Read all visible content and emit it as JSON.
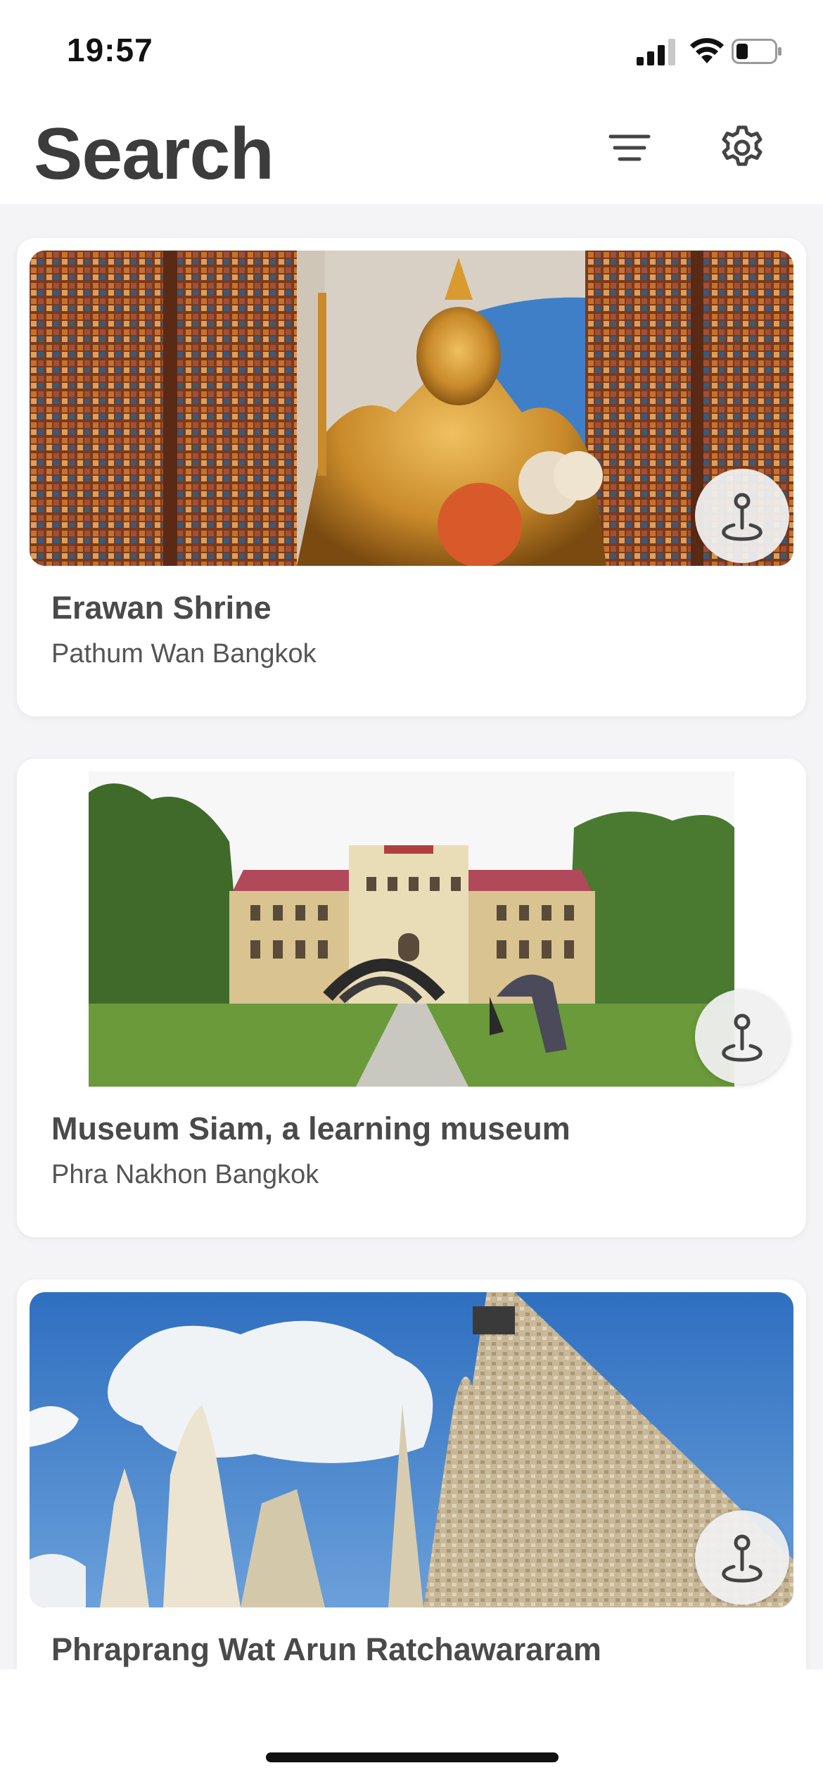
{
  "status_bar": {
    "time": "19:57"
  },
  "header": {
    "title": "Search",
    "filter_icon": "filter-lines-icon",
    "settings_icon": "gear-icon"
  },
  "places": [
    {
      "name": "Erawan Shrine",
      "location": "Pathum Wan Bangkok",
      "action_icon": "map-pin-icon"
    },
    {
      "name": "Museum Siam, a learning museum",
      "location": "Phra Nakhon Bangkok",
      "action_icon": "map-pin-icon"
    },
    {
      "name": "Phraprang Wat Arun Ratchawararam",
      "location": "",
      "action_icon": "map-pin-icon"
    }
  ],
  "colors": {
    "title": "#3c3c3c",
    "text": "#4a4a4a",
    "list_background": "#f4f4f6",
    "card": "#ffffff"
  }
}
